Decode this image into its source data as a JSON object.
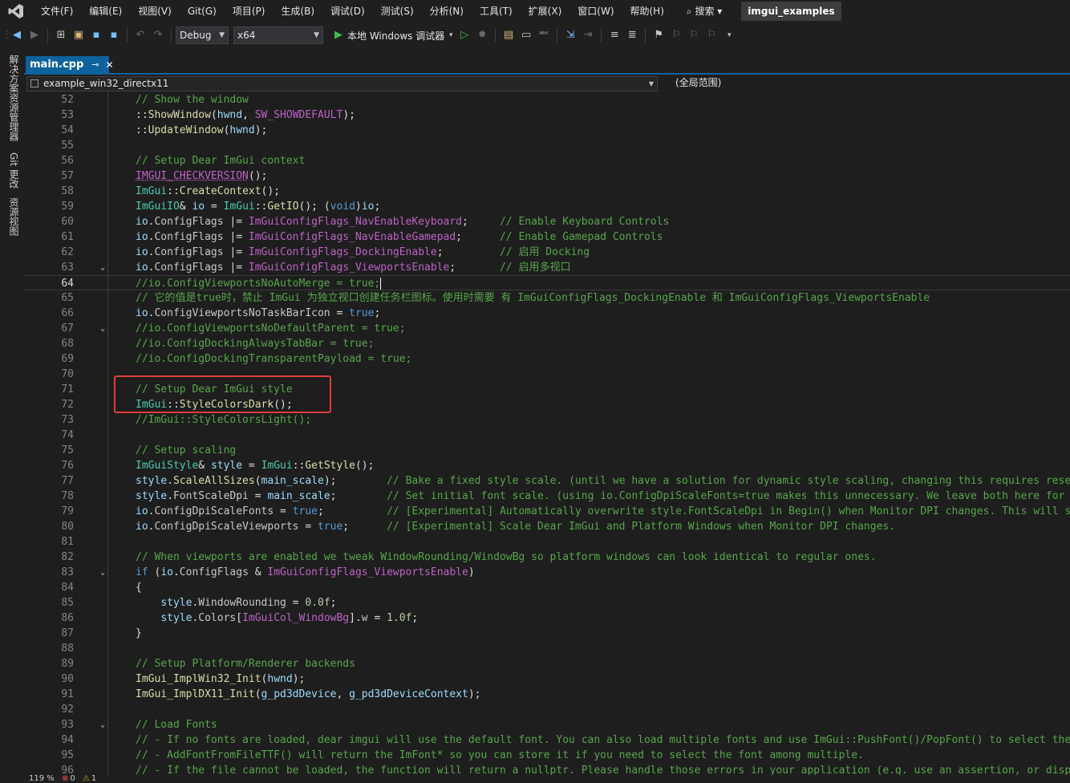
{
  "menubar": {
    "items": [
      "文件(F)",
      "编辑(E)",
      "视图(V)",
      "Git(G)",
      "项目(P)",
      "生成(B)",
      "调试(D)",
      "测试(S)",
      "分析(N)",
      "工具(T)",
      "扩展(X)",
      "窗口(W)",
      "帮助(H)"
    ],
    "search_label": "搜索",
    "solution_name": "imgui_examples"
  },
  "toolbar": {
    "configuration": "Debug",
    "platform": "x64",
    "run_label": "本地 Windows 调试器"
  },
  "sidebar": {
    "tabs": [
      "解决方案资源管理器",
      "Git 更改",
      "资源视图"
    ]
  },
  "editor_tab": {
    "filename": "main.cpp"
  },
  "navbar": {
    "project": "example_win32_directx11",
    "scope": "(全局范围)"
  },
  "code": {
    "line_numbers": [
      "52",
      "53",
      "54",
      "55",
      "56",
      "57",
      "58",
      "59",
      "60",
      "61",
      "62",
      "63",
      "64",
      "65",
      "66",
      "67",
      "68",
      "69",
      "70",
      "71",
      "72",
      "73",
      "74",
      "75",
      "76",
      "77",
      "78",
      "79",
      "80",
      "81",
      "82",
      "83",
      "84",
      "85",
      "86",
      "87",
      "88",
      "89",
      "90",
      "91",
      "92",
      "93",
      "94",
      "95",
      "96"
    ],
    "current_line": "64"
  },
  "statusbar": {
    "zoom": "119 %",
    "errors": "0",
    "warnings": "1"
  },
  "colors": {
    "accent": "#0e639c",
    "comment": "#57a64a",
    "keyword": "#569cd6",
    "type": "#4ec9b0",
    "function": "#dcdcaa",
    "highlight_box": "#e03c3c"
  }
}
